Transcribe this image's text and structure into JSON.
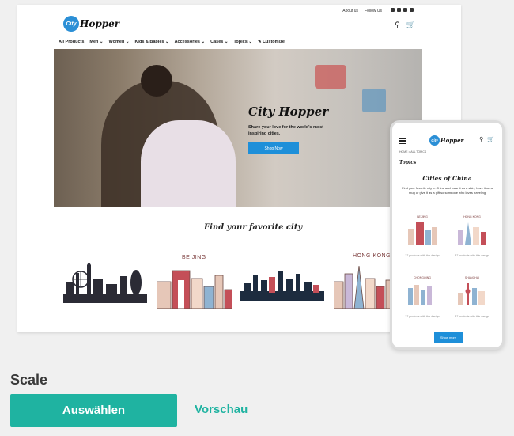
{
  "desktop": {
    "topbar": {
      "about": "About us",
      "follow": "Follow Us"
    },
    "logo": {
      "badge": "City",
      "text": "Hopper"
    },
    "nav": [
      "All Products",
      "Men ⌄",
      "Women ⌄",
      "Kids & Babies ⌄",
      "Accessories ⌄",
      "Cases ⌄",
      "Topics ⌄",
      "✎ Customize"
    ],
    "hero": {
      "title": "City Hopper",
      "subtitle": "Share your love for the world's most inspiring cities.",
      "button": "Shop Now"
    },
    "section_title": "Find your favorite city",
    "cities": [
      "BEIJING",
      "HONG KONG"
    ]
  },
  "phone": {
    "breadcrumb": "HOME  >  ALL TOPICS",
    "topics": "Topics",
    "title": "Cities of China",
    "description": "Find your favorite city in China and wear it as a shirt, have it on a mug or give it as a gift so someone who loves traveling",
    "cities": [
      "BEIJING",
      "HONG KONG",
      "CHONGQING",
      "SHANGHAI"
    ],
    "note": "37 products with this design",
    "button": "Show more"
  },
  "scale_label": "Scale",
  "select_button": "Auswählen",
  "preview_link": "Vorschau",
  "colors": {
    "accent": "#1fb3a1",
    "blue": "#1e8fd9"
  }
}
